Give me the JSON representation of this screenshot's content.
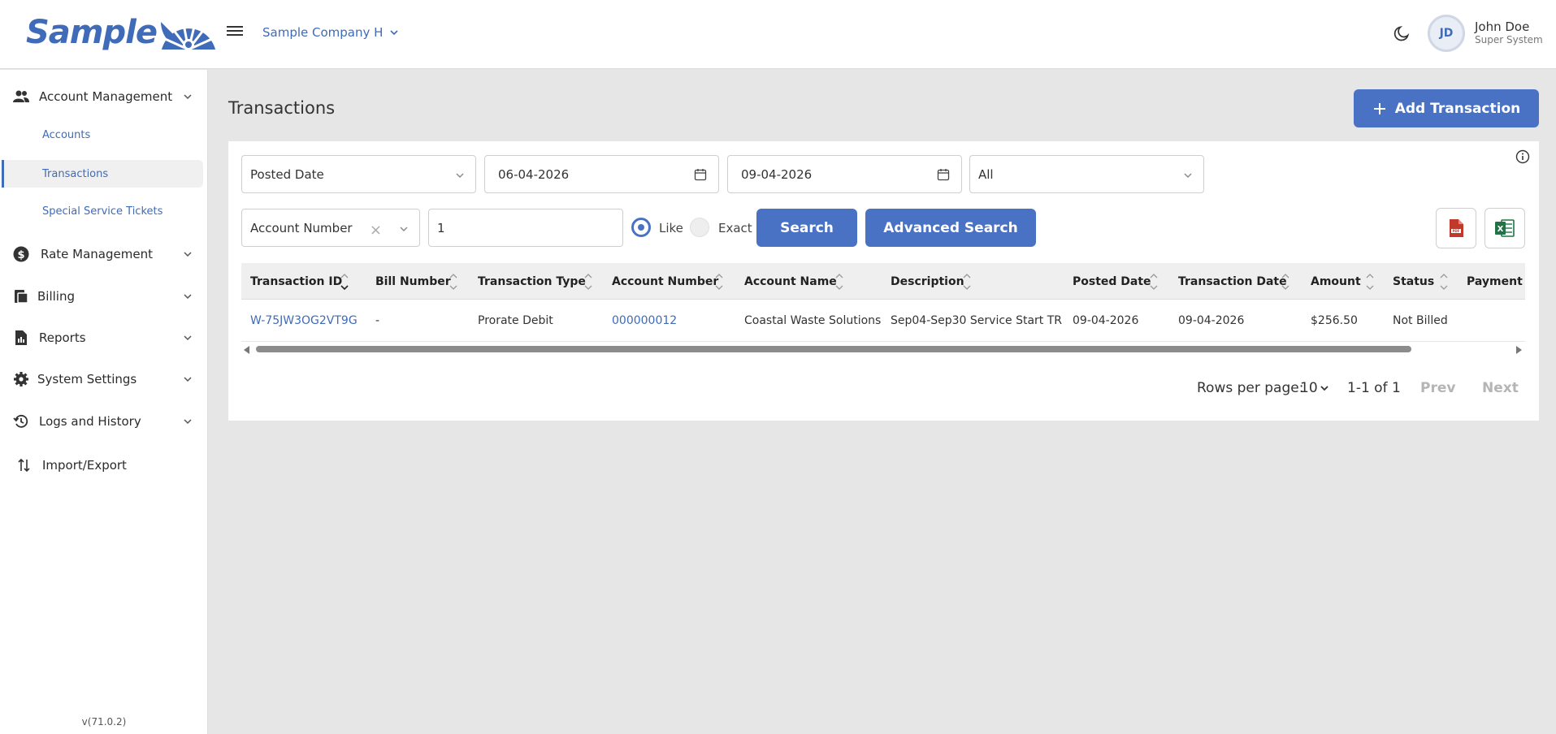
{
  "header": {
    "logo_text": "Sample",
    "company": "Sample Company H",
    "user_initials": "JD",
    "user_name": "John Doe",
    "user_role": "Super System"
  },
  "sidebar": {
    "account_management": "Account Management",
    "accounts": "Accounts",
    "transactions": "Transactions",
    "special_service_tickets": "Special Service Tickets",
    "rate_management": "Rate Management",
    "billing": "Billing",
    "reports": "Reports",
    "system_settings": "System Settings",
    "logs_and_history": "Logs and History",
    "import_export": "Import/Export",
    "version": "v(71.0.2)"
  },
  "page": {
    "title": "Transactions",
    "add_button": "Add Transaction"
  },
  "filters": {
    "date_type": "Posted Date",
    "start_date": "06-04-2026",
    "end_date": "09-04-2026",
    "status": "All",
    "search_field": "Account Number",
    "search_value": "1",
    "like_label": "Like",
    "exact_label": "Exact",
    "search_button": "Search",
    "advanced_search_button": "Advanced Search"
  },
  "table": {
    "columns": [
      "Transaction ID",
      "Bill Number",
      "Transaction Type",
      "Account Number",
      "Account Name",
      "Description",
      "Posted Date",
      "Transaction Date",
      "Amount",
      "Status",
      "Payment S"
    ],
    "rows": [
      [
        "W-75JW3OG2VT9G",
        "-",
        "Prorate Debit",
        "000000012",
        "Coastal Waste Solutions",
        "Sep04-Sep30 Service Start TR",
        "09-04-2026",
        "09-04-2026",
        "$256.50",
        "Not Billed",
        ""
      ]
    ]
  },
  "pagination": {
    "rows_per_page_label": "Rows per page:",
    "rows_per_page": "10",
    "range": "1-1 of 1",
    "prev": "Prev",
    "next": "Next"
  }
}
